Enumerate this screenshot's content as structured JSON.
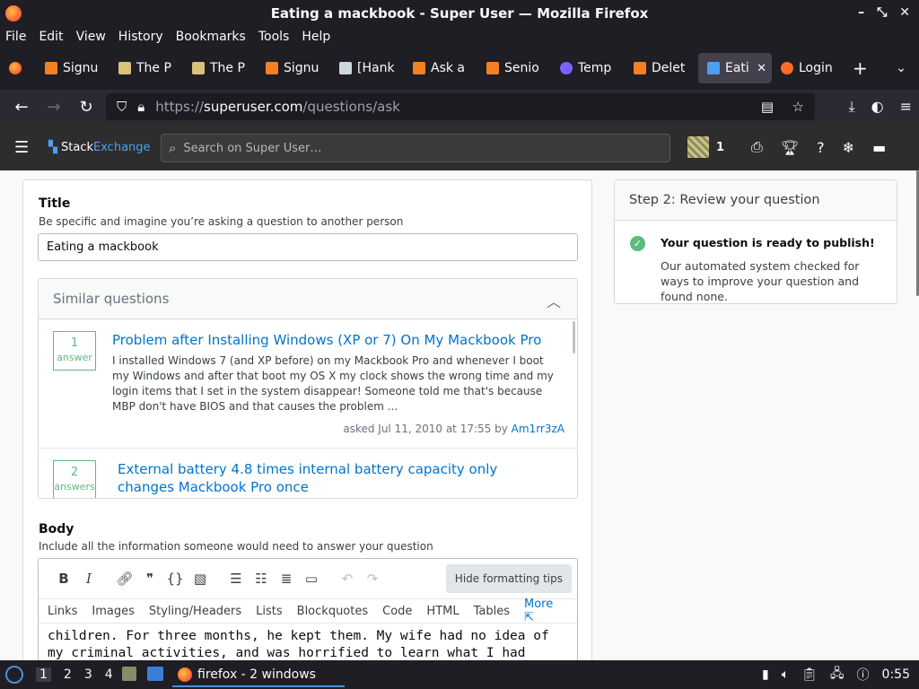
{
  "window": {
    "title": "Eating a mackbook - Super User — Mozilla Firefox"
  },
  "menu": [
    "File",
    "Edit",
    "View",
    "History",
    "Bookmarks",
    "Tools",
    "Help"
  ],
  "tabs": [
    {
      "label": "Signu",
      "color": "#f48024"
    },
    {
      "label": "The P",
      "color": "#d9c27a"
    },
    {
      "label": "The P",
      "color": "#d9c27a"
    },
    {
      "label": "Signu",
      "color": "#f48024"
    },
    {
      "label": "[Hank",
      "color": "#cfd8dc"
    },
    {
      "label": "Ask a",
      "color": "#f48024"
    },
    {
      "label": "Senio",
      "color": "#f48024"
    },
    {
      "label": "Temp",
      "color": "#7b61ff"
    },
    {
      "label": "Delet",
      "color": "#f48024"
    },
    {
      "label": "Eati",
      "color": "#4e9ff2",
      "active": true
    },
    {
      "label": "Login",
      "color": "#ff6b28"
    }
  ],
  "url": {
    "prefix": "https://",
    "host": "superuser.com",
    "path": "/questions/ask"
  },
  "se": {
    "brand_stack": "Stack",
    "brand_exchange": "Exchange",
    "search_placeholder": "Search on Super User…",
    "rep": "1"
  },
  "form": {
    "title_label": "Title",
    "title_hint": "Be specific and imagine you’re asking a question to another person",
    "title_value": "Eating a mackbook",
    "similar_header": "Similar questions",
    "similar": [
      {
        "count": "1",
        "unit": "answer",
        "title": "Problem after Installing Windows (XP or 7) On My Mackbook Pro",
        "excerpt": "I installed Windows 7 (and XP before) on my Mackbook Pro and whenever I boot my Windows and after that boot my OS X my clock shows the wrong time and my login items that I set in the system disappear! Someone told me that's because MBP don't have BIOS and that causes the problem ...",
        "meta": "asked Jul 11, 2010 at 17:55 by",
        "author": "Am1rr3zA"
      },
      {
        "count": "2",
        "unit": "answers",
        "title": "External battery 4.8 times internal battery capacity only changes Mackbook Pro once"
      }
    ],
    "body_label": "Body",
    "body_hint": "Include all the information someone would need to answer your question",
    "hide_tips": "Hide formatting tips",
    "tips": [
      "Links",
      "Images",
      "Styling/Headers",
      "Lists",
      "Blockquotes",
      "Code",
      "HTML",
      "Tables"
    ],
    "tips_more": "More",
    "body_line1": "children. For three months, he kept them. My wife had no idea of",
    "body_line2": "my criminal activities, and was horrified to learn what I had"
  },
  "review": {
    "header": "Step 2: Review your question",
    "ready": "Your question is ready to publish!",
    "desc": "Our automated system checked for ways to improve your question and found none."
  },
  "taskbar": {
    "workspaces": [
      "1",
      "2",
      "3",
      "4"
    ],
    "app": "firefox - 2 windows",
    "clock": "0:55"
  }
}
